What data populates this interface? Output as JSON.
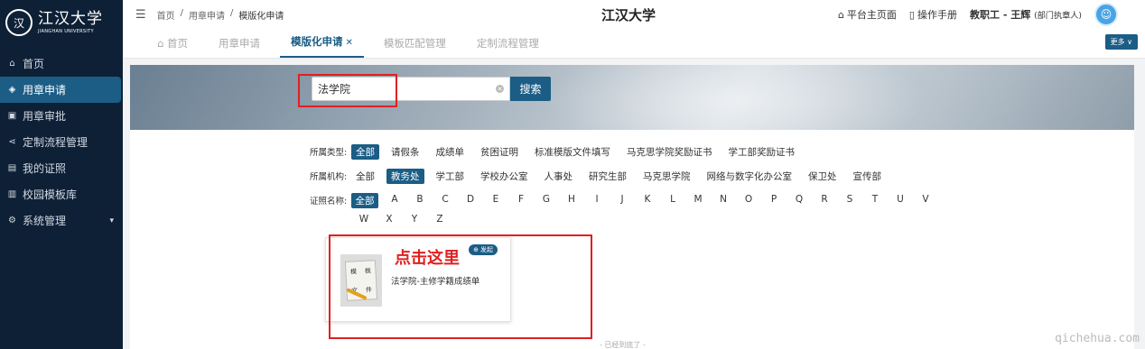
{
  "sidebar": {
    "logo_cn": "江汉大学",
    "logo_en": "JIANGHAN UNIVERSITY",
    "items": [
      {
        "label": "首页",
        "icon": "home-icon"
      },
      {
        "label": "用章申请",
        "icon": "stamp-icon",
        "active": true
      },
      {
        "label": "用章审批",
        "icon": "approve-icon"
      },
      {
        "label": "定制流程管理",
        "icon": "flow-icon"
      },
      {
        "label": "我的证照",
        "icon": "license-icon"
      },
      {
        "label": "校园模板库",
        "icon": "template-icon"
      },
      {
        "label": "系统管理",
        "icon": "settings-icon",
        "has_children": true
      }
    ]
  },
  "header": {
    "breadcrumb": [
      "首页",
      "用章申请",
      "模版化申请"
    ],
    "title": "江汉大学",
    "home_link": "平台主页面",
    "manual_link": "操作手册",
    "user_name": "教职工 - 王辉",
    "user_role": "(部门执章人)"
  },
  "tabs": [
    {
      "label": "首页",
      "active": false
    },
    {
      "label": "用章申请",
      "active": false
    },
    {
      "label": "模版化申请",
      "active": true
    },
    {
      "label": "模板匹配管理",
      "active": false
    },
    {
      "label": "定制流程管理",
      "active": false
    }
  ],
  "more_label": "更多",
  "search": {
    "value": "法学院",
    "button": "搜索"
  },
  "filters": {
    "type_label": "所属类型:",
    "types": [
      "全部",
      "请假条",
      "成绩单",
      "贫困证明",
      "标准模版文件填写",
      "马克思学院奖励证书",
      "学工部奖励证书"
    ],
    "type_selected": 0,
    "org_label": "所属机构:",
    "orgs": [
      "全部",
      "教务处",
      "学工部",
      "学校办公室",
      "人事处",
      "研究生部",
      "马克思学院",
      "网络与数字化办公室",
      "保卫处",
      "宣传部"
    ],
    "org_selected": 1,
    "name_label": "证照名称:",
    "letters_row1": [
      "全部",
      "A",
      "B",
      "C",
      "D",
      "E",
      "F",
      "G",
      "H",
      "I",
      "J",
      "K",
      "L",
      "M",
      "N",
      "O",
      "P",
      "Q",
      "R",
      "S",
      "T",
      "U",
      "V"
    ],
    "letters_row2": [
      "W",
      "X",
      "Y",
      "Z"
    ]
  },
  "card": {
    "title": "法学院-主修学籍成绩单",
    "badge": "发起",
    "thumb_chars": [
      "模",
      "板",
      "文",
      "件"
    ]
  },
  "annotation": "点击这里",
  "end_text": "- 已经到底了 -",
  "watermark": "qichehua.com",
  "colors": {
    "accent": "#1b5d85",
    "sidebar_bg": "#0e2036",
    "highlight": "#e02020"
  }
}
